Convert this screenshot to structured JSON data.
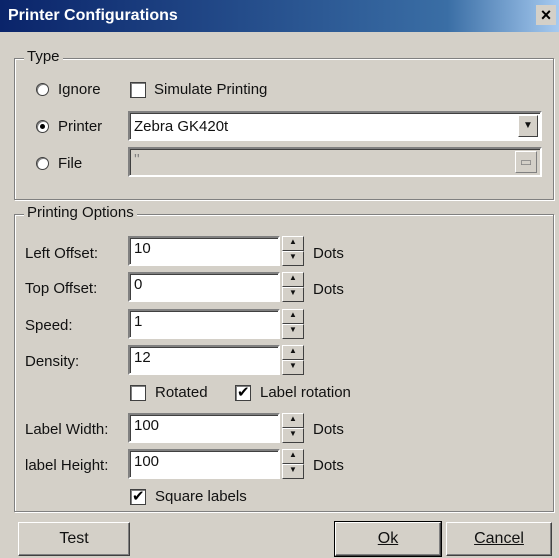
{
  "window": {
    "title": "Printer Configurations",
    "close_glyph": "×"
  },
  "type_group": {
    "legend": "Type",
    "ignore_label": "Ignore",
    "printer_label": "Printer",
    "file_label": "File",
    "simulate_label": "Simulate Printing",
    "selected_type": "Printer",
    "simulate_checked": false,
    "printer_value": "Zebra  GK420t",
    "file_value": "''"
  },
  "options_group": {
    "legend": "Printing Options",
    "left_offset": {
      "label": "Left Offset:",
      "value": "10",
      "unit": "Dots"
    },
    "top_offset": {
      "label": "Top Offset:",
      "value": "0",
      "unit": "Dots"
    },
    "speed": {
      "label": "Speed:",
      "value": "1"
    },
    "density": {
      "label": "Density:",
      "value": "12"
    },
    "rotated": {
      "label": "Rotated",
      "checked": false
    },
    "label_rotation": {
      "label": "Label rotation",
      "checked": true
    },
    "label_width": {
      "label": "Label Width:",
      "value": "100",
      "unit": "Dots"
    },
    "label_height": {
      "label": "label Height:",
      "value": "100",
      "unit": "Dots"
    },
    "square_labels": {
      "label": "Square labels",
      "checked": true
    }
  },
  "buttons": {
    "test": "Test",
    "ok": "Ok",
    "cancel": "Cancel"
  }
}
